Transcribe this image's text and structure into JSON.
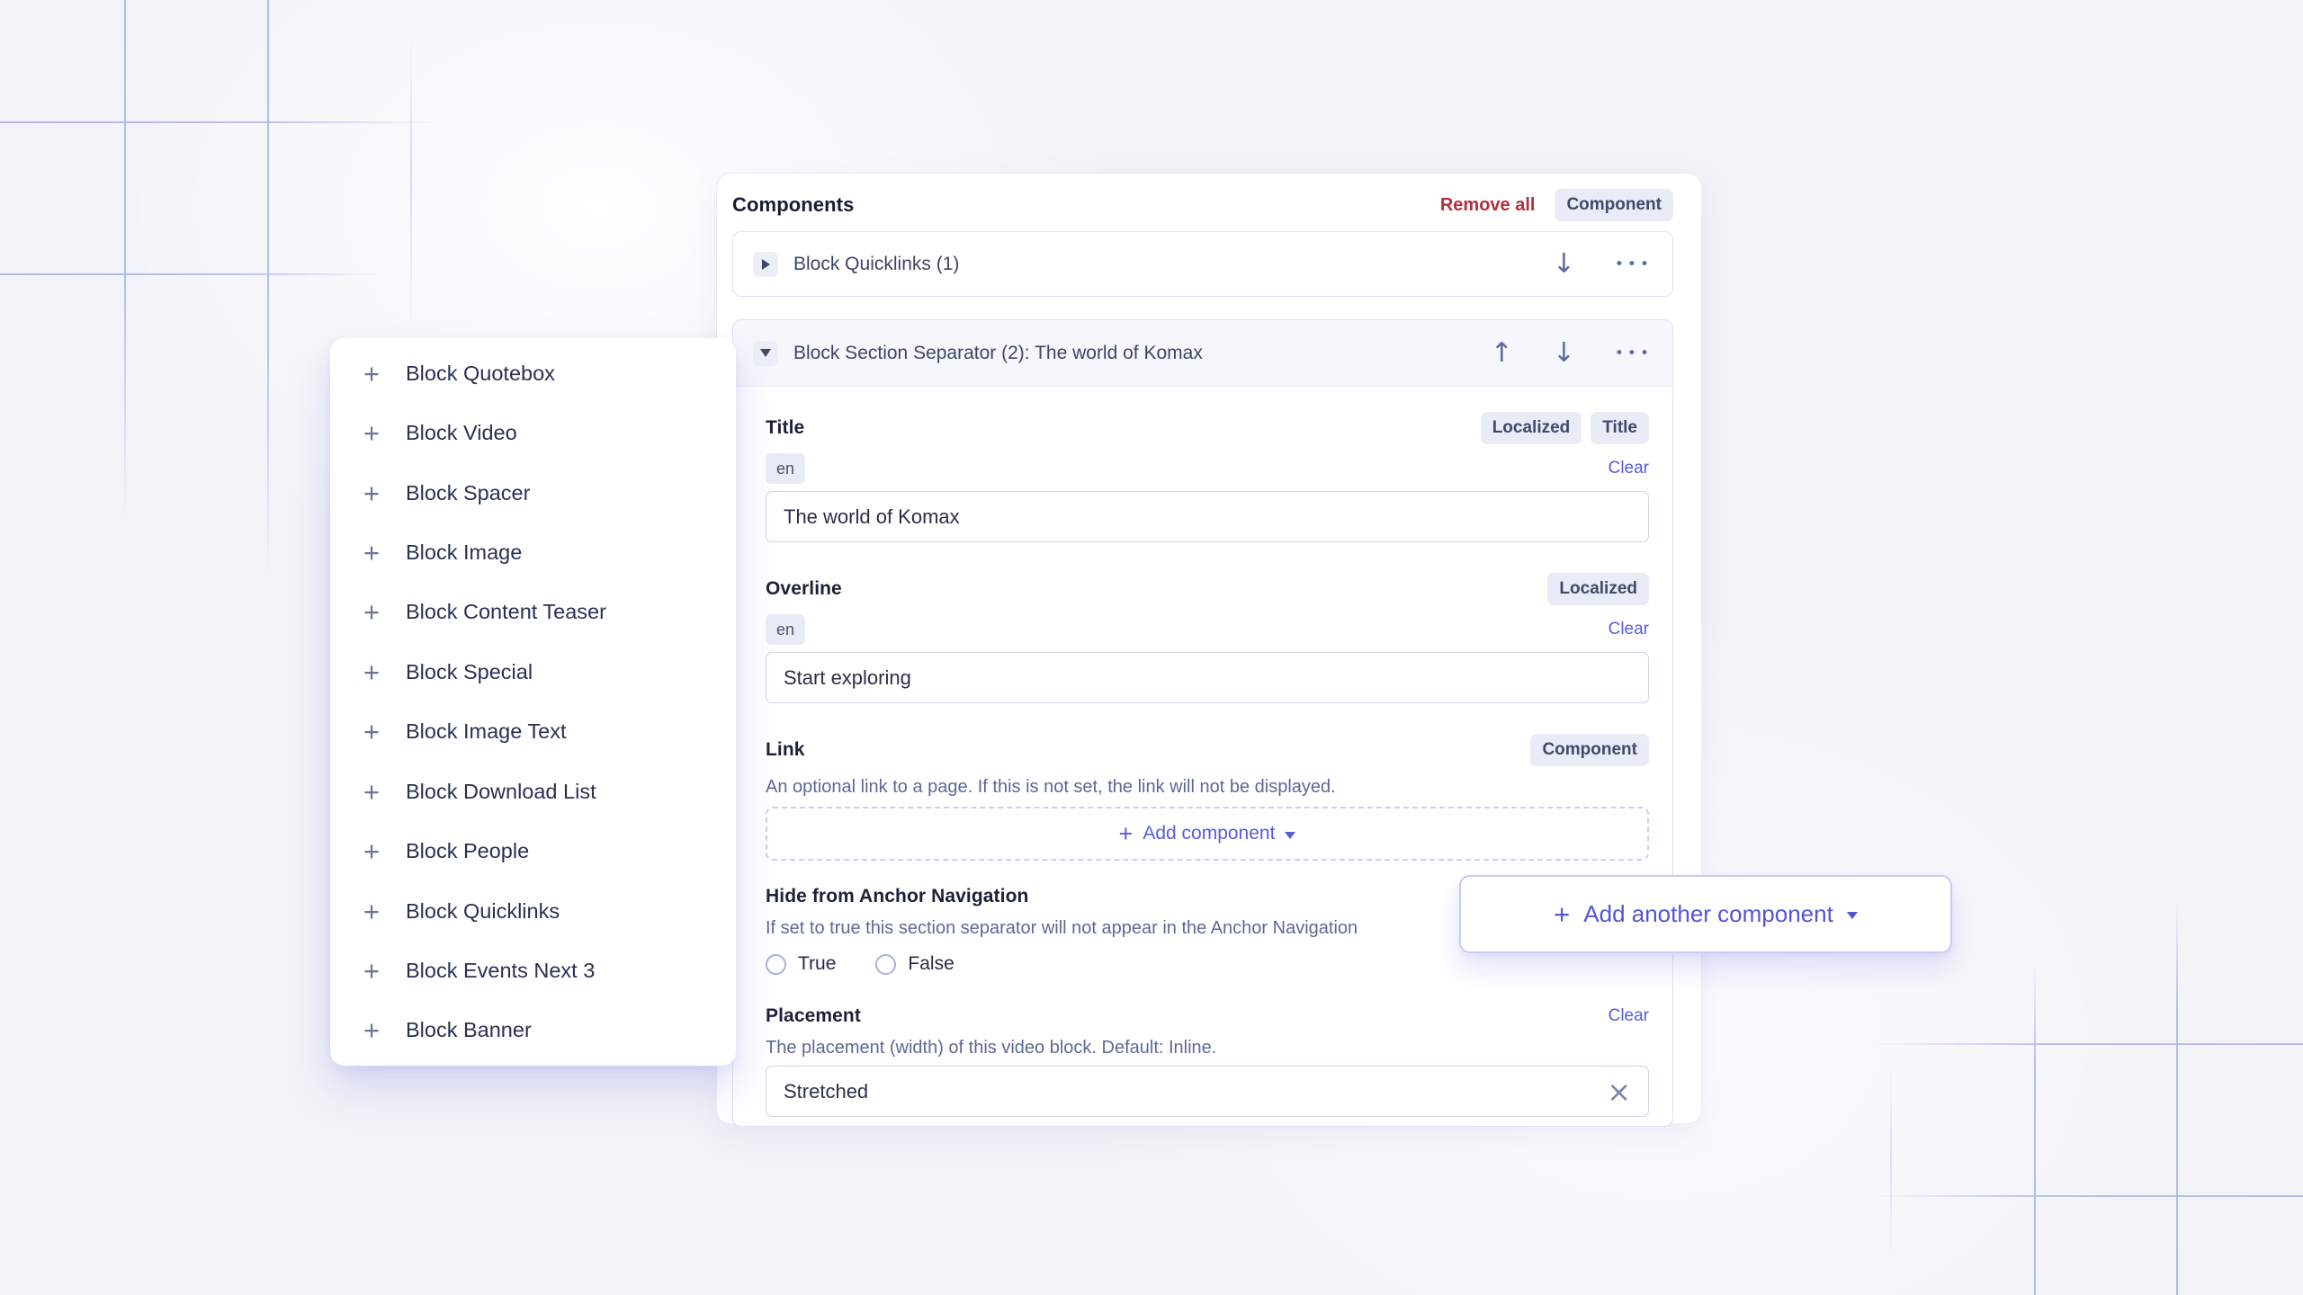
{
  "colors": {
    "accent": "#565dd6",
    "danger": "#b12f3f",
    "badge_bg": "#e9ecf7",
    "grid_line": "#b0b7ee",
    "panel_bg": "#ffffff",
    "block_header_bg": "#f6f7fc"
  },
  "icons": {
    "plus": "+",
    "move_up": "↑",
    "move_down": "↓",
    "more": "•••",
    "clear_x": "×"
  },
  "menu": {
    "items": [
      {
        "label": "Block Quotebox"
      },
      {
        "label": "Block Video"
      },
      {
        "label": "Block Spacer"
      },
      {
        "label": "Block Image"
      },
      {
        "label": "Block Content Teaser"
      },
      {
        "label": "Block Special"
      },
      {
        "label": "Block Image Text"
      },
      {
        "label": "Block Download List"
      },
      {
        "label": "Block People"
      },
      {
        "label": "Block Quicklinks"
      },
      {
        "label": "Block Events Next 3"
      },
      {
        "label": "Block Banner"
      }
    ]
  },
  "panel": {
    "title": "Components",
    "remove_all_label": "Remove all",
    "type_badge": "Component",
    "collapsed_item": {
      "title": "Block Quicklinks (1)"
    },
    "expanded_item": {
      "title": "Block Section Separator (2): The world of Komax",
      "fields": {
        "title": {
          "label": "Title",
          "badges": [
            "Localized",
            "Title"
          ],
          "locale": "en",
          "clear_label": "Clear",
          "value": "The world of Komax"
        },
        "overline": {
          "label": "Overline",
          "badges": [
            "Localized"
          ],
          "locale": "en",
          "clear_label": "Clear",
          "value": "Start exploring"
        },
        "link": {
          "label": "Link",
          "badge": "Component",
          "description": "An optional link to a page. If this is not set, the link will not be displayed.",
          "add_component_label": "Add component"
        },
        "hide_from_anchor_navigation": {
          "label": "Hide from Anchor Navigation",
          "description": "If set to true this section separator will not appear in the Anchor Navigation",
          "options": [
            "True",
            "False"
          ]
        },
        "placement": {
          "label": "Placement",
          "clear_label": "Clear",
          "description": "The placement (width) of this video block. Default: Inline.",
          "value": "Stretched"
        }
      }
    }
  },
  "add_another": {
    "label": "Add another component"
  }
}
